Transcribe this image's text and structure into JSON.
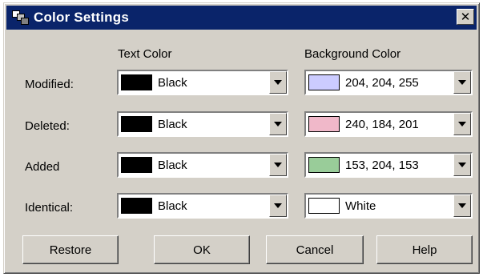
{
  "window": {
    "title": "Color Settings"
  },
  "columns": {
    "text_color": "Text Color",
    "background_color": "Background Color"
  },
  "rows": [
    {
      "label": "Modified:",
      "text_value": "Black",
      "text_swatch": "#000000",
      "bg_value": "204, 204, 255",
      "bg_swatch": "#ccccff"
    },
    {
      "label": "Deleted:",
      "text_value": "Black",
      "text_swatch": "#000000",
      "bg_value": "240, 184, 201",
      "bg_swatch": "#f0b8c9"
    },
    {
      "label": "Added",
      "text_value": "Black",
      "text_swatch": "#000000",
      "bg_value": "153, 204, 153",
      "bg_swatch": "#99cc99"
    },
    {
      "label": "Identical:",
      "text_value": "Black",
      "text_swatch": "#000000",
      "bg_value": "White",
      "bg_swatch": "#ffffff"
    }
  ],
  "buttons": {
    "restore": "Restore",
    "ok": "OK",
    "cancel": "Cancel",
    "help": "Help"
  },
  "colors": {
    "titlebar": "#0a246a",
    "dialog_face": "#d4d0c8"
  }
}
